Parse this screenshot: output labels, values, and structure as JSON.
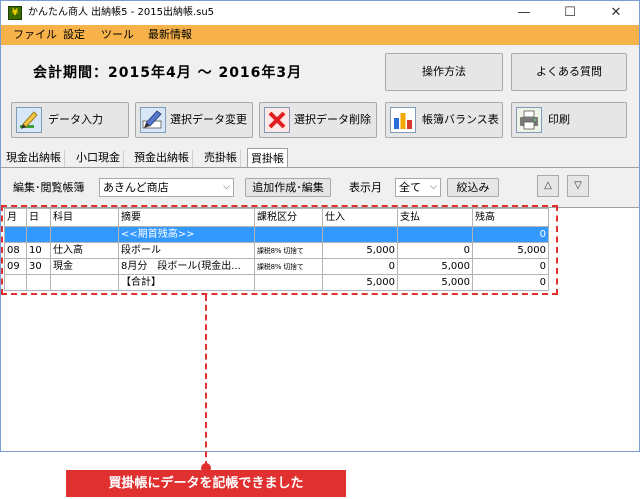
{
  "window": {
    "title": "かんたん商人 出納帳5 - 2015出納帳.su5",
    "app_icon": "app-logo-icon",
    "controls": {
      "minimize": "—",
      "maximize": "☐",
      "close": "✕"
    }
  },
  "menu": {
    "file": "ファイル",
    "settings": "設定",
    "tools": "ツール",
    "news": "最新情報"
  },
  "period": {
    "label": "会計期間：2015年4月 ～ 2016年3月"
  },
  "help_buttons": {
    "howto": "操作方法",
    "faq": "よくある質問"
  },
  "toolbar": {
    "entry": {
      "label": "データ入力",
      "icon": "pencil-icon"
    },
    "edit": {
      "label": "選択データ変更",
      "icon": "edit-pen-icon"
    },
    "delete": {
      "label": "選択データ削除",
      "icon": "delete-x-icon"
    },
    "balance": {
      "label": "帳簿バランス表",
      "icon": "bar-chart-icon"
    },
    "print": {
      "label": "印刷",
      "icon": "printer-icon"
    }
  },
  "tabs": {
    "cash": "現金出納帳",
    "petty": "小口現金",
    "deposit": "預金出納帳",
    "receivable": "売掛帳",
    "payable": "買掛帳",
    "active": "payable"
  },
  "filter": {
    "book_label": "編集･閲覧帳簿",
    "book_value": "あきんど商店",
    "add_button": "追加作成･編集",
    "month_label": "表示月",
    "month_value": "全て",
    "narrow_button": "絞込み",
    "up": "△",
    "down": "▽"
  },
  "ledger": {
    "headers": {
      "month": "月",
      "day": "日",
      "account": "科目",
      "description": "摘要",
      "tax": "課税区分",
      "purchase": "仕入",
      "payment": "支払",
      "balance": "残高"
    },
    "opening": {
      "description": "<<期首残高>>",
      "balance": "0"
    },
    "rows": [
      {
        "month": "08",
        "day": "10",
        "account": "仕入高",
        "description": "段ボール",
        "tax": "課税8% 切捨て",
        "purchase": "5,000",
        "payment": "0",
        "balance": "5,000"
      },
      {
        "month": "09",
        "day": "30",
        "account": "現金",
        "description": "8月分　段ボール(現金出...",
        "tax": "課税8% 切捨て",
        "purchase": "0",
        "payment": "5,000",
        "balance": "0"
      }
    ],
    "total": {
      "description": "【合計】",
      "purchase": "5,000",
      "payment": "5,000",
      "balance": "0"
    }
  },
  "caption": "買掛帳にデータを記帳できました",
  "colors": {
    "menubar": "#f7b34a",
    "highlight": "#e03030",
    "selected_row": "#3399ff"
  }
}
